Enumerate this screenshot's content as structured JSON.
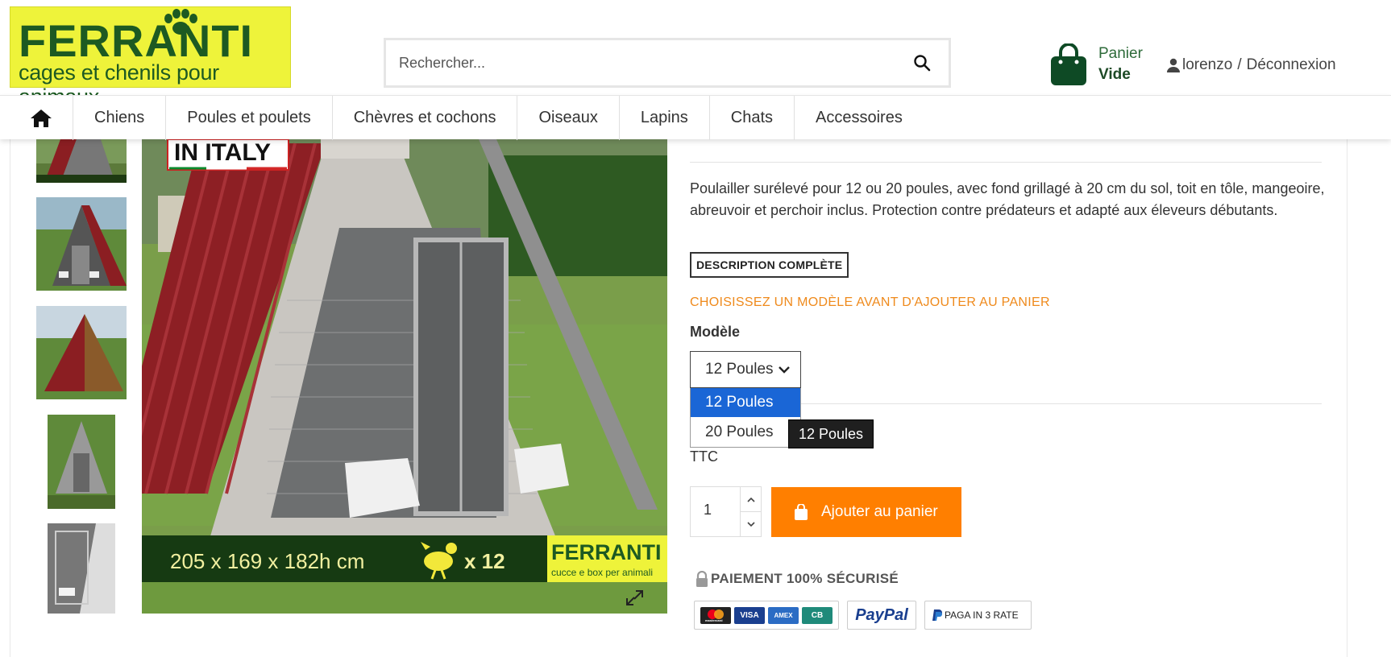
{
  "header": {
    "logo_brand": "FERRANTI",
    "logo_tagline": "cages et chenils pour animaux",
    "search_placeholder": "Rechercher...",
    "cart_label": "Panier",
    "cart_status": "Vide",
    "user_name": "lorenzo",
    "separator": "/",
    "logout_label": "Déconnexion"
  },
  "nav": {
    "items": [
      "Chiens",
      "Poules et poulets",
      "Chèvres et cochons",
      "Oiseaux",
      "Lapins",
      "Chats",
      "Accessoires"
    ]
  },
  "gallery": {
    "badge_text": "IN ITALY",
    "banner_dimensions": "205 x 169 x 182h cm",
    "banner_count": "x 12",
    "banner_brand": "FERRANTI",
    "banner_tagline": "cucce e box per animali"
  },
  "product": {
    "description": "Poulailler surélevé pour 12 ou 20 poules, avec fond grillagé à 20 cm du sol, toit en tôle, mangeoire, abreuvoir et perchoir inclus. Protection contre prédateurs et adapté aux éleveurs débutants.",
    "full_description_label": "DESCRIPTION COMPLÈTE",
    "choose_notice": "CHOISISSEZ UN MODÈLE AVANT D'AJOUTER AU PANIER",
    "model_label": "Modèle",
    "model_selected": "12 Poules",
    "model_options": [
      "12 Poules",
      "20 Poules"
    ],
    "tooltip": "12 Poules",
    "ttc_label": "TTC",
    "quantity": "1",
    "add_to_cart_label": "Ajouter au panier",
    "secure_label": "PAIEMENT 100% SÉCURISÉ",
    "payment": {
      "cards": [
        "mastercard",
        "VISA",
        "AMEX",
        "CB"
      ],
      "paypal": "PayPal",
      "paypal_installments": "PAGA IN 3 RATE"
    }
  },
  "colors": {
    "accent_orange": "#ff7f00",
    "notice_orange": "#ef8a1c",
    "brand_green": "#1d5a22",
    "logo_yellow": "#eef33a",
    "selected_option": "#1a66d6"
  }
}
